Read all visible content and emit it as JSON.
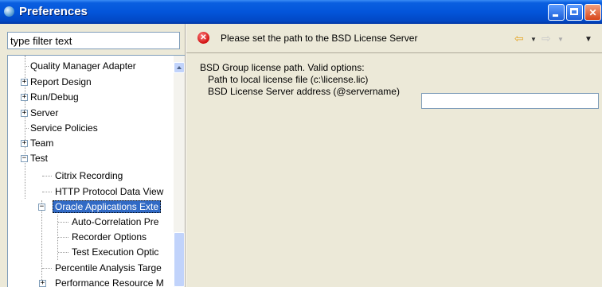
{
  "window": {
    "title": "Preferences"
  },
  "filter": {
    "placeholder": "type filter text"
  },
  "tree": {
    "items": [
      {
        "label": "Quality Manager Adapter"
      },
      {
        "label": "Report Design",
        "toggle": "+"
      },
      {
        "label": "Run/Debug",
        "toggle": "+"
      },
      {
        "label": "Server",
        "toggle": "+"
      },
      {
        "label": "Service Policies"
      },
      {
        "label": "Team",
        "toggle": "+"
      },
      {
        "label": "Test",
        "toggle": "−"
      },
      {
        "label": "Citrix Recording"
      },
      {
        "label": "HTTP Protocol Data View"
      },
      {
        "label": "Oracle Applications Exte",
        "toggle": "−"
      },
      {
        "label": "Auto-Correlation Pre"
      },
      {
        "label": "Recorder Options"
      },
      {
        "label": "Test Execution Optic"
      },
      {
        "label": "Percentile Analysis Targe"
      },
      {
        "label": "Performance Resource M",
        "toggle": "+"
      }
    ]
  },
  "header": {
    "error_message": "Please set the path to the BSD License Server"
  },
  "content": {
    "line1": "BSD Group license path.  Valid options:",
    "line2": "Path to local license file (c:\\license.lic)",
    "line3": "BSD License Server address (@servername)",
    "path_value": ""
  },
  "icons": {
    "error": "error-icon",
    "back": "back-arrow-icon",
    "forward": "forward-arrow-icon",
    "menu": "view-menu-icon"
  },
  "colors": {
    "titlebar": "#0355DA",
    "selection": "#316AC5",
    "background": "#ECE9D8"
  }
}
